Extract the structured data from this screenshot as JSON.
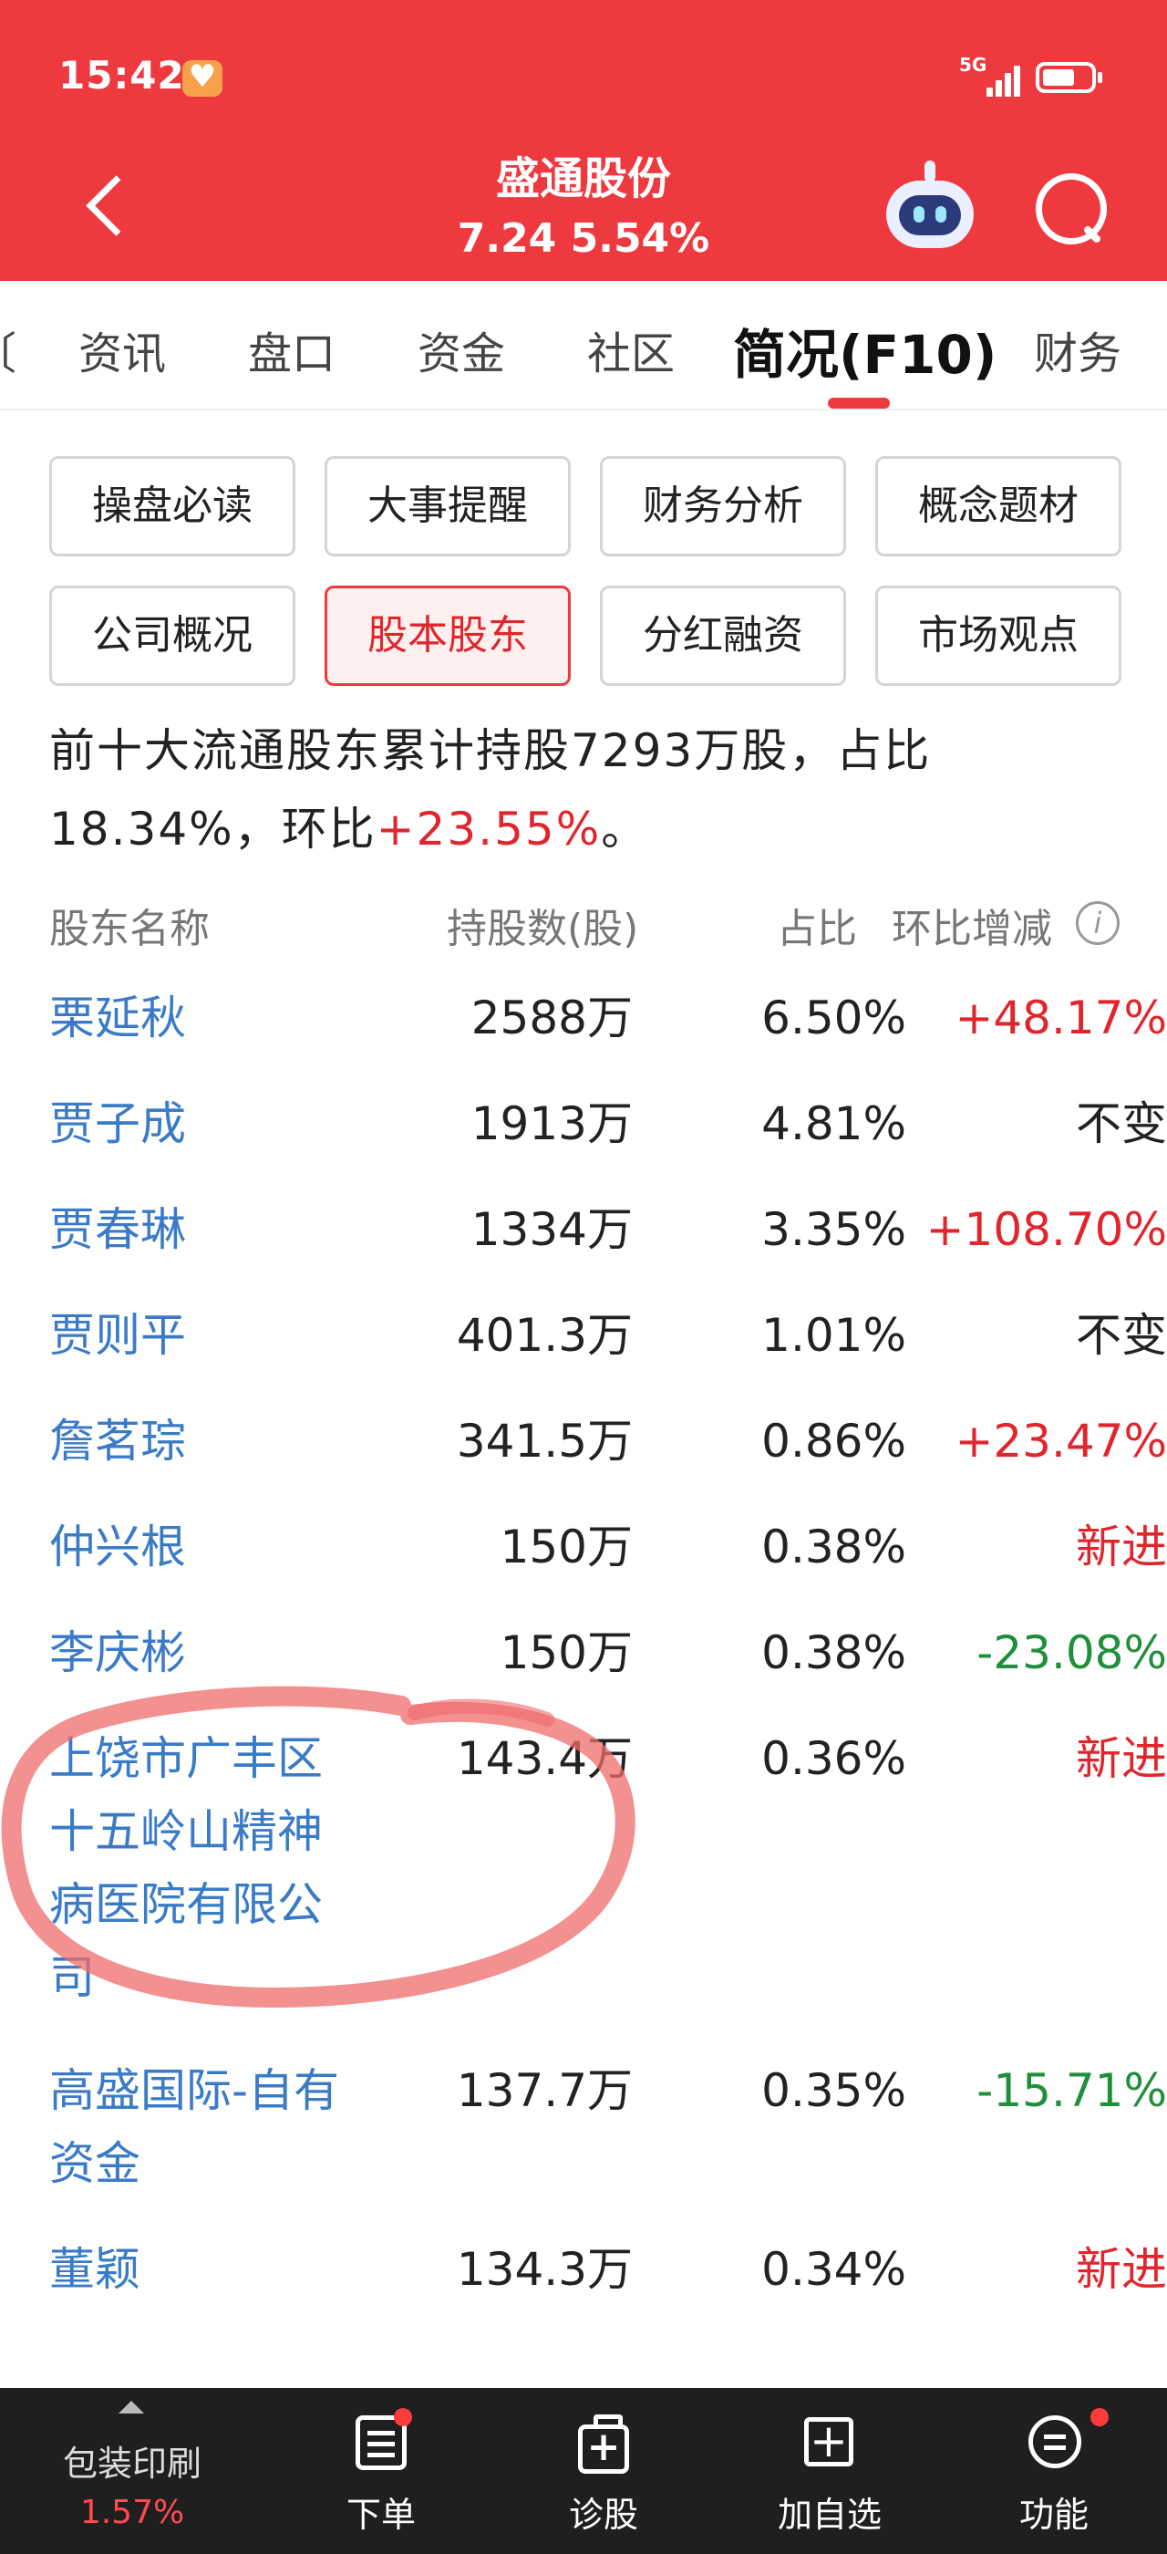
{
  "status_bar": {
    "time": "15:42",
    "network": "5G"
  },
  "nav": {
    "stock_name": "盛通股份",
    "quote": "7.24  5.54%"
  },
  "tabs": [
    {
      "label": "资讯",
      "active": false
    },
    {
      "label": "盘口",
      "active": false
    },
    {
      "label": "资金",
      "active": false
    },
    {
      "label": "社区",
      "active": false
    },
    {
      "label": "简况(F10)",
      "active": true
    },
    {
      "label": "财务",
      "active": false
    }
  ],
  "sub_buttons": [
    {
      "label": "操盘必读",
      "active": false
    },
    {
      "label": "大事提醒",
      "active": false
    },
    {
      "label": "财务分析",
      "active": false
    },
    {
      "label": "概念题材",
      "active": false
    },
    {
      "label": "公司概况",
      "active": false
    },
    {
      "label": "股本股东",
      "active": true
    },
    {
      "label": "分红融资",
      "active": false
    },
    {
      "label": "市场观点",
      "active": false
    }
  ],
  "summary": {
    "prefix": "前十大流通股东累计持股7293万股，占比18.34%，环比",
    "change": "+23.55%",
    "suffix": "。"
  },
  "table": {
    "headers": {
      "name": "股东名称",
      "shares": "持股数(股)",
      "ratio": "占比",
      "change": "环比增减"
    },
    "rows": [
      {
        "name": "栗延秋",
        "shares": "2588万",
        "ratio": "6.50%",
        "change": "+48.17%",
        "trend": "up"
      },
      {
        "name": "贾子成",
        "shares": "1913万",
        "ratio": "4.81%",
        "change": "不变",
        "trend": "flat"
      },
      {
        "name": "贾春琳",
        "shares": "1334万",
        "ratio": "3.35%",
        "change": "+108.70%",
        "trend": "up"
      },
      {
        "name": "贾则平",
        "shares": "401.3万",
        "ratio": "1.01%",
        "change": "不变",
        "trend": "flat"
      },
      {
        "name": "詹茗琮",
        "shares": "341.5万",
        "ratio": "0.86%",
        "change": "+23.47%",
        "trend": "up"
      },
      {
        "name": "仲兴根",
        "shares": "150万",
        "ratio": "0.38%",
        "change": "新进",
        "trend": "up"
      },
      {
        "name": "李庆彬",
        "shares": "150万",
        "ratio": "0.38%",
        "change": "-23.08%",
        "trend": "down"
      },
      {
        "name": "上饶市广丰区十五岭山精神病医院有限公司",
        "shares": "143.4万",
        "ratio": "0.36%",
        "change": "新进",
        "trend": "up"
      },
      {
        "name": "高盛国际-自有资金",
        "shares": "137.7万",
        "ratio": "0.35%",
        "change": "-15.71%",
        "trend": "down"
      },
      {
        "name": "董颖",
        "shares": "134.3万",
        "ratio": "0.34%",
        "change": "新进",
        "trend": "up"
      }
    ]
  },
  "bottom_bar": {
    "sector": {
      "name": "包装印刷",
      "change": "1.57%"
    },
    "items": [
      {
        "label": "下单",
        "icon": "order-icon"
      },
      {
        "label": "诊股",
        "icon": "diagnose-icon"
      },
      {
        "label": "加自选",
        "icon": "add-watchlist-icon"
      },
      {
        "label": "功能",
        "icon": "function-icon"
      }
    ]
  },
  "colors": {
    "header_red": "#ee3a3f",
    "up_red": "#e0262d",
    "down_green": "#1f8f3a",
    "link_blue": "#3a7bc8",
    "bottom_bar": "#1f1f1f"
  }
}
